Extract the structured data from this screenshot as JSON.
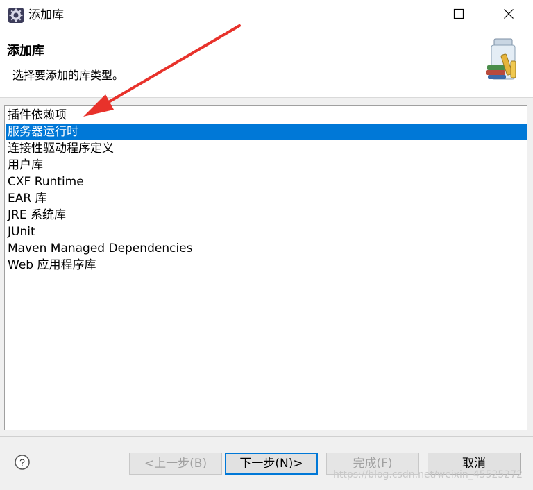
{
  "window": {
    "title": "添加库"
  },
  "header": {
    "title": "添加库",
    "description": "选择要添加的库类型。"
  },
  "library_types": [
    {
      "label": "插件依赖项",
      "selected": false
    },
    {
      "label": "服务器运行时",
      "selected": true
    },
    {
      "label": "连接性驱动程序定义",
      "selected": false
    },
    {
      "label": "用户库",
      "selected": false
    },
    {
      "label": "CXF Runtime",
      "selected": false
    },
    {
      "label": "EAR 库",
      "selected": false
    },
    {
      "label": "JRE 系统库",
      "selected": false
    },
    {
      "label": "JUnit",
      "selected": false
    },
    {
      "label": "Maven Managed Dependencies",
      "selected": false
    },
    {
      "label": "Web 应用程序库",
      "selected": false
    }
  ],
  "buttons": {
    "back": "<上一步(B)",
    "next": "下一步(N)>",
    "finish": "完成(F)",
    "cancel": "取消"
  },
  "watermark": "https://blog.csdn.net/weixin_45525272",
  "colors": {
    "selection": "#0078d7",
    "annotation_arrow": "#e8322b"
  },
  "icons": {
    "app": "eclipse-gear-icon",
    "minimize": "minimize-icon",
    "maximize": "maximize-icon",
    "close": "close-icon",
    "header": "library-jar-icon",
    "help": "help-icon"
  }
}
